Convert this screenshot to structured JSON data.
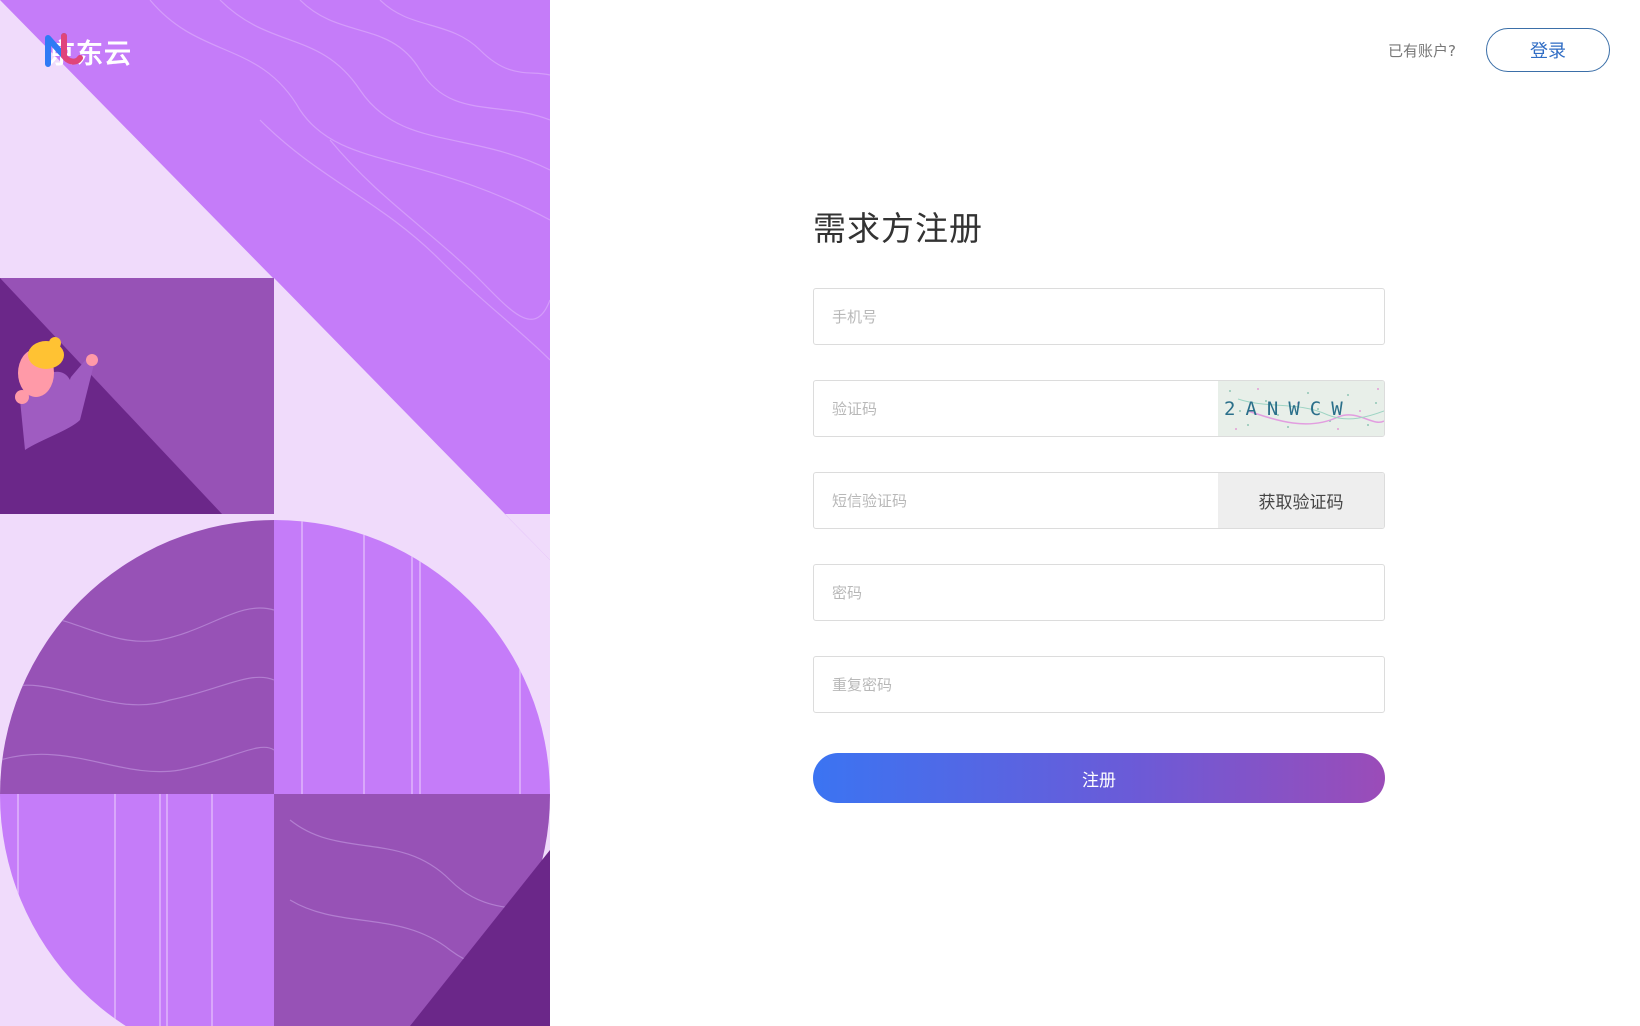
{
  "brand": {
    "name": "京东云",
    "logo_icon": "jdcloud-logo-icon"
  },
  "header": {
    "have_account_text": "已有账户?",
    "login_label": "登录"
  },
  "form": {
    "title": "需求方注册",
    "phone_placeholder": "手机号",
    "captcha_placeholder": "验证码",
    "captcha_text": "2ANWCW",
    "sms_placeholder": "短信验证码",
    "get_sms_code_label": "获取验证码",
    "password_placeholder": "密码",
    "repeat_password_placeholder": "重复密码",
    "register_label": "注册"
  },
  "colors": {
    "panel_light": "#f0dbfb",
    "panel_mid": "#c57cf9",
    "panel_dark": "#9752b6",
    "panel_deep": "#6b2789",
    "primary_blue": "#3b74f2",
    "gradient_end": "#9b4cb8"
  }
}
